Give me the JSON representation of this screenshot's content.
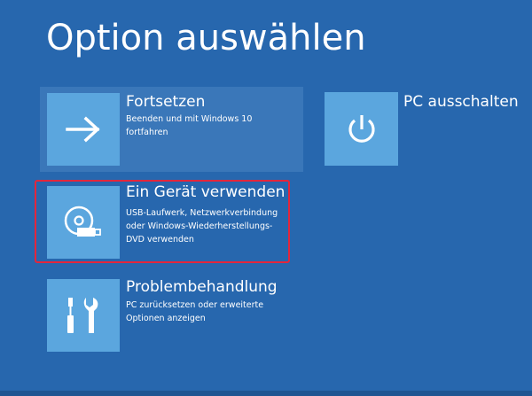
{
  "header": {
    "title": "Option auswählen"
  },
  "options": {
    "continue": {
      "title": "Fortsetzen",
      "desc_line1": "Beenden und mit Windows 10",
      "desc_line2": "fortfahren",
      "icon": "arrow-right-icon"
    },
    "shutdown": {
      "title": "PC ausschalten",
      "icon": "power-icon"
    },
    "use_device": {
      "title": "Ein Gerät verwenden",
      "desc_line1": "USB-Laufwerk, Netzwerkverbindung",
      "desc_line2": "oder Windows-Wiederherstellungs-",
      "desc_line3": "DVD verwenden",
      "icon": "disc-drive-icon"
    },
    "troubleshoot": {
      "title": "Problembehandlung",
      "desc_line1": "PC zurücksetzen oder erweiterte",
      "desc_line2": "Optionen anzeigen",
      "icon": "tools-icon"
    }
  },
  "colors": {
    "background": "#2767ae",
    "tile": "#5ba6de",
    "hover_panel": "#3a77b9",
    "highlight_border": "#e3263c"
  }
}
